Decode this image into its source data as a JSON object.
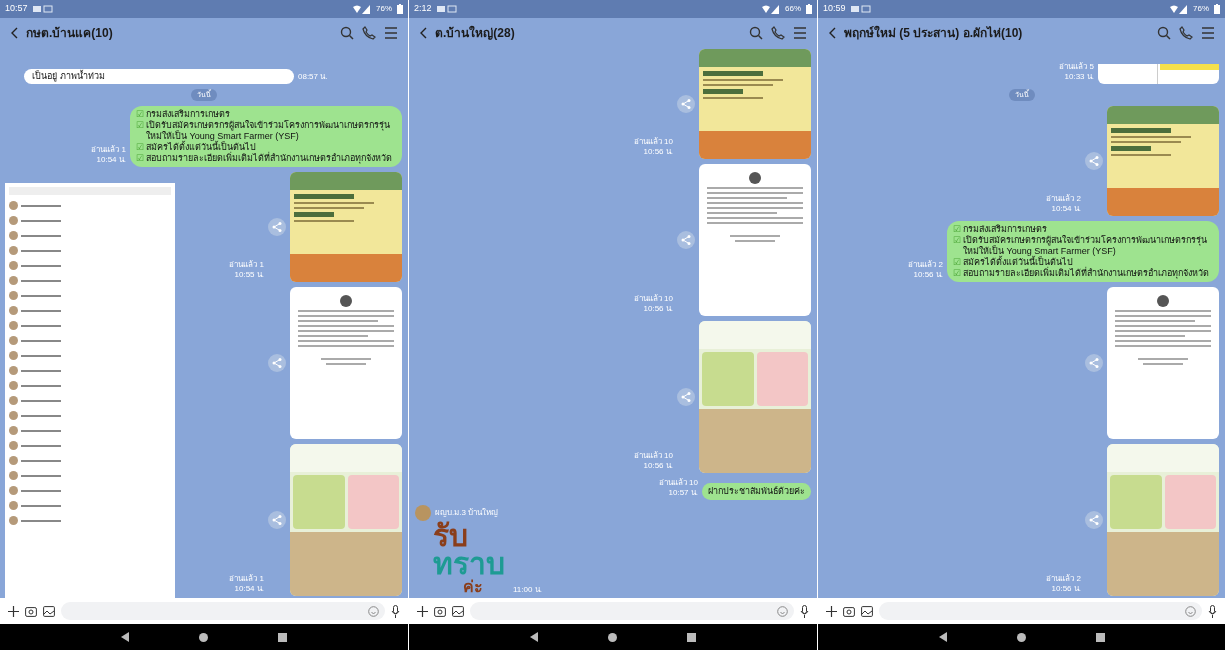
{
  "panels": [
    {
      "status_bar": {
        "time": "10:57",
        "battery": "76%"
      },
      "title": "กษต.บ้านแค(10)",
      "messages": [
        {
          "kind": "incoming_text",
          "text": "เป็นอยู่ ภาพน้ำท่วม",
          "time": "08:57 น."
        },
        {
          "kind": "date",
          "text": "วันนี้"
        },
        {
          "kind": "outgoing_text",
          "lines": [
            {
              "mark": "☑",
              "text": "กรมส่งเสริมการเกษตร"
            },
            {
              "mark": "☑",
              "text": "เปิดรับสมัครเกษตรกรผู้สนใจเข้าร่วมโครงการพัฒนาเกษตรกรรุ่นใหม่ให้เป็น Young Smart Farmer (YSF)"
            },
            {
              "mark": "☑",
              "text": "สมัครได้ตั้งแต่วันนี้เป็นต้นไป"
            },
            {
              "mark": "☑",
              "text": "สอบถามรายละเอียดเพิ่มเติมได้ที่สำนักงานเกษตรอำเภอทุกจังหวัด"
            }
          ],
          "read": "อ่านแล้ว 1",
          "time": "10:54 น."
        },
        {
          "kind": "screenshot"
        },
        {
          "kind": "poster",
          "read": "อ่านแล้ว 1",
          "time": "10:55 น."
        },
        {
          "kind": "document"
        },
        {
          "kind": "flyer",
          "read": "อ่านแล้ว 1",
          "time": "10:54 น."
        }
      ]
    },
    {
      "status_bar": {
        "time": "2:12",
        "battery": "66%"
      },
      "title": "ต.บ้านใหญ่(28)",
      "messages": [
        {
          "kind": "poster",
          "read": "อ่านแล้ว 10",
          "time": "10:56 น."
        },
        {
          "kind": "document",
          "read": "อ่านแล้ว 10",
          "time": "10:56 น."
        },
        {
          "kind": "flyer",
          "read": "อ่านแล้ว 10",
          "time": "10:56 น."
        },
        {
          "kind": "outgoing_text",
          "text": "ฝากประชาสัมพันธ์ด้วยค่ะ",
          "read": "อ่านแล้ว 10",
          "time": "10:57 น."
        },
        {
          "kind": "sticker",
          "sender": "ผญบ.ม.3 บ้านใหญ่",
          "lines": [
            "รับ",
            "ทราบ",
            "ค่ะ"
          ],
          "time": "11:00 น."
        }
      ]
    },
    {
      "status_bar": {
        "time": "10:59",
        "battery": "76%"
      },
      "title": "พฤกษ์ใหม่ (5 ประสาน) อ.ผักไห่(10)",
      "messages": [
        {
          "kind": "table",
          "read": "อ่านแล้ว 5",
          "time": "10:33 น."
        },
        {
          "kind": "date",
          "text": "วันนี้"
        },
        {
          "kind": "poster",
          "read": "อ่านแล้ว 2",
          "time": "10:54 น."
        },
        {
          "kind": "outgoing_text",
          "lines": [
            {
              "mark": "☑",
              "text": "กรมส่งเสริมการเกษตร"
            },
            {
              "mark": "☑",
              "text": "เปิดรับสมัครเกษตรกรผู้สนใจเข้าร่วมโครงการพัฒนาเกษตรกรรุ่นใหม่ให้เป็น Young Smart Farmer (YSF)"
            },
            {
              "mark": "☑",
              "text": "สมัครได้ตั้งแต่วันนี้เป็นต้นไป"
            },
            {
              "mark": "☑",
              "text": "สอบถามรายละเอียดเพิ่มเติมได้ที่สำนักงานเกษตรอำเภอทุกจังหวัด"
            }
          ],
          "read": "อ่านแล้ว 2",
          "time": "10:56 น."
        },
        {
          "kind": "document"
        },
        {
          "kind": "flyer",
          "read": "อ่านแล้ว 2",
          "time": "10:56 น."
        }
      ]
    }
  ]
}
